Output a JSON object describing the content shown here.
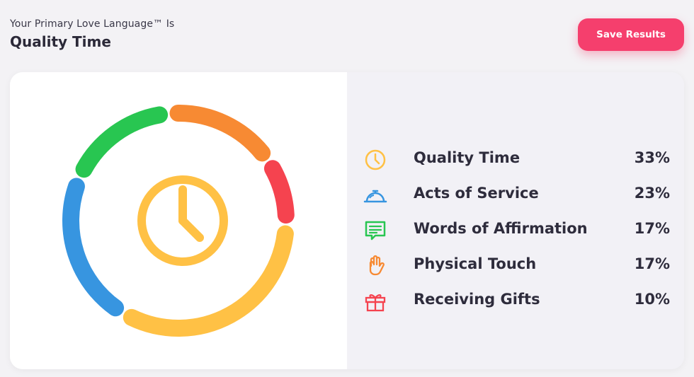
{
  "header": {
    "subtitle": "Your Primary Love Language™ Is",
    "title": "Quality Time"
  },
  "actions": {
    "save_label": "Save Results"
  },
  "results": [
    {
      "label": "Quality Time",
      "percent": "33%",
      "value": 33,
      "color": "#ffc145",
      "icon": "clock-icon"
    },
    {
      "label": "Acts of Service",
      "percent": "23%",
      "value": 23,
      "color": "#3795e0",
      "icon": "service-bell-icon"
    },
    {
      "label": "Words of Affirmation",
      "percent": "17%",
      "value": 17,
      "color": "#28c651",
      "icon": "speech-bubble-icon"
    },
    {
      "label": "Physical Touch",
      "percent": "17%",
      "value": 17,
      "color": "#f78a33",
      "icon": "hand-icon"
    },
    {
      "label": "Receiving Gifts",
      "percent": "10%",
      "value": 10,
      "color": "#f5434f",
      "icon": "gift-icon"
    }
  ]
}
